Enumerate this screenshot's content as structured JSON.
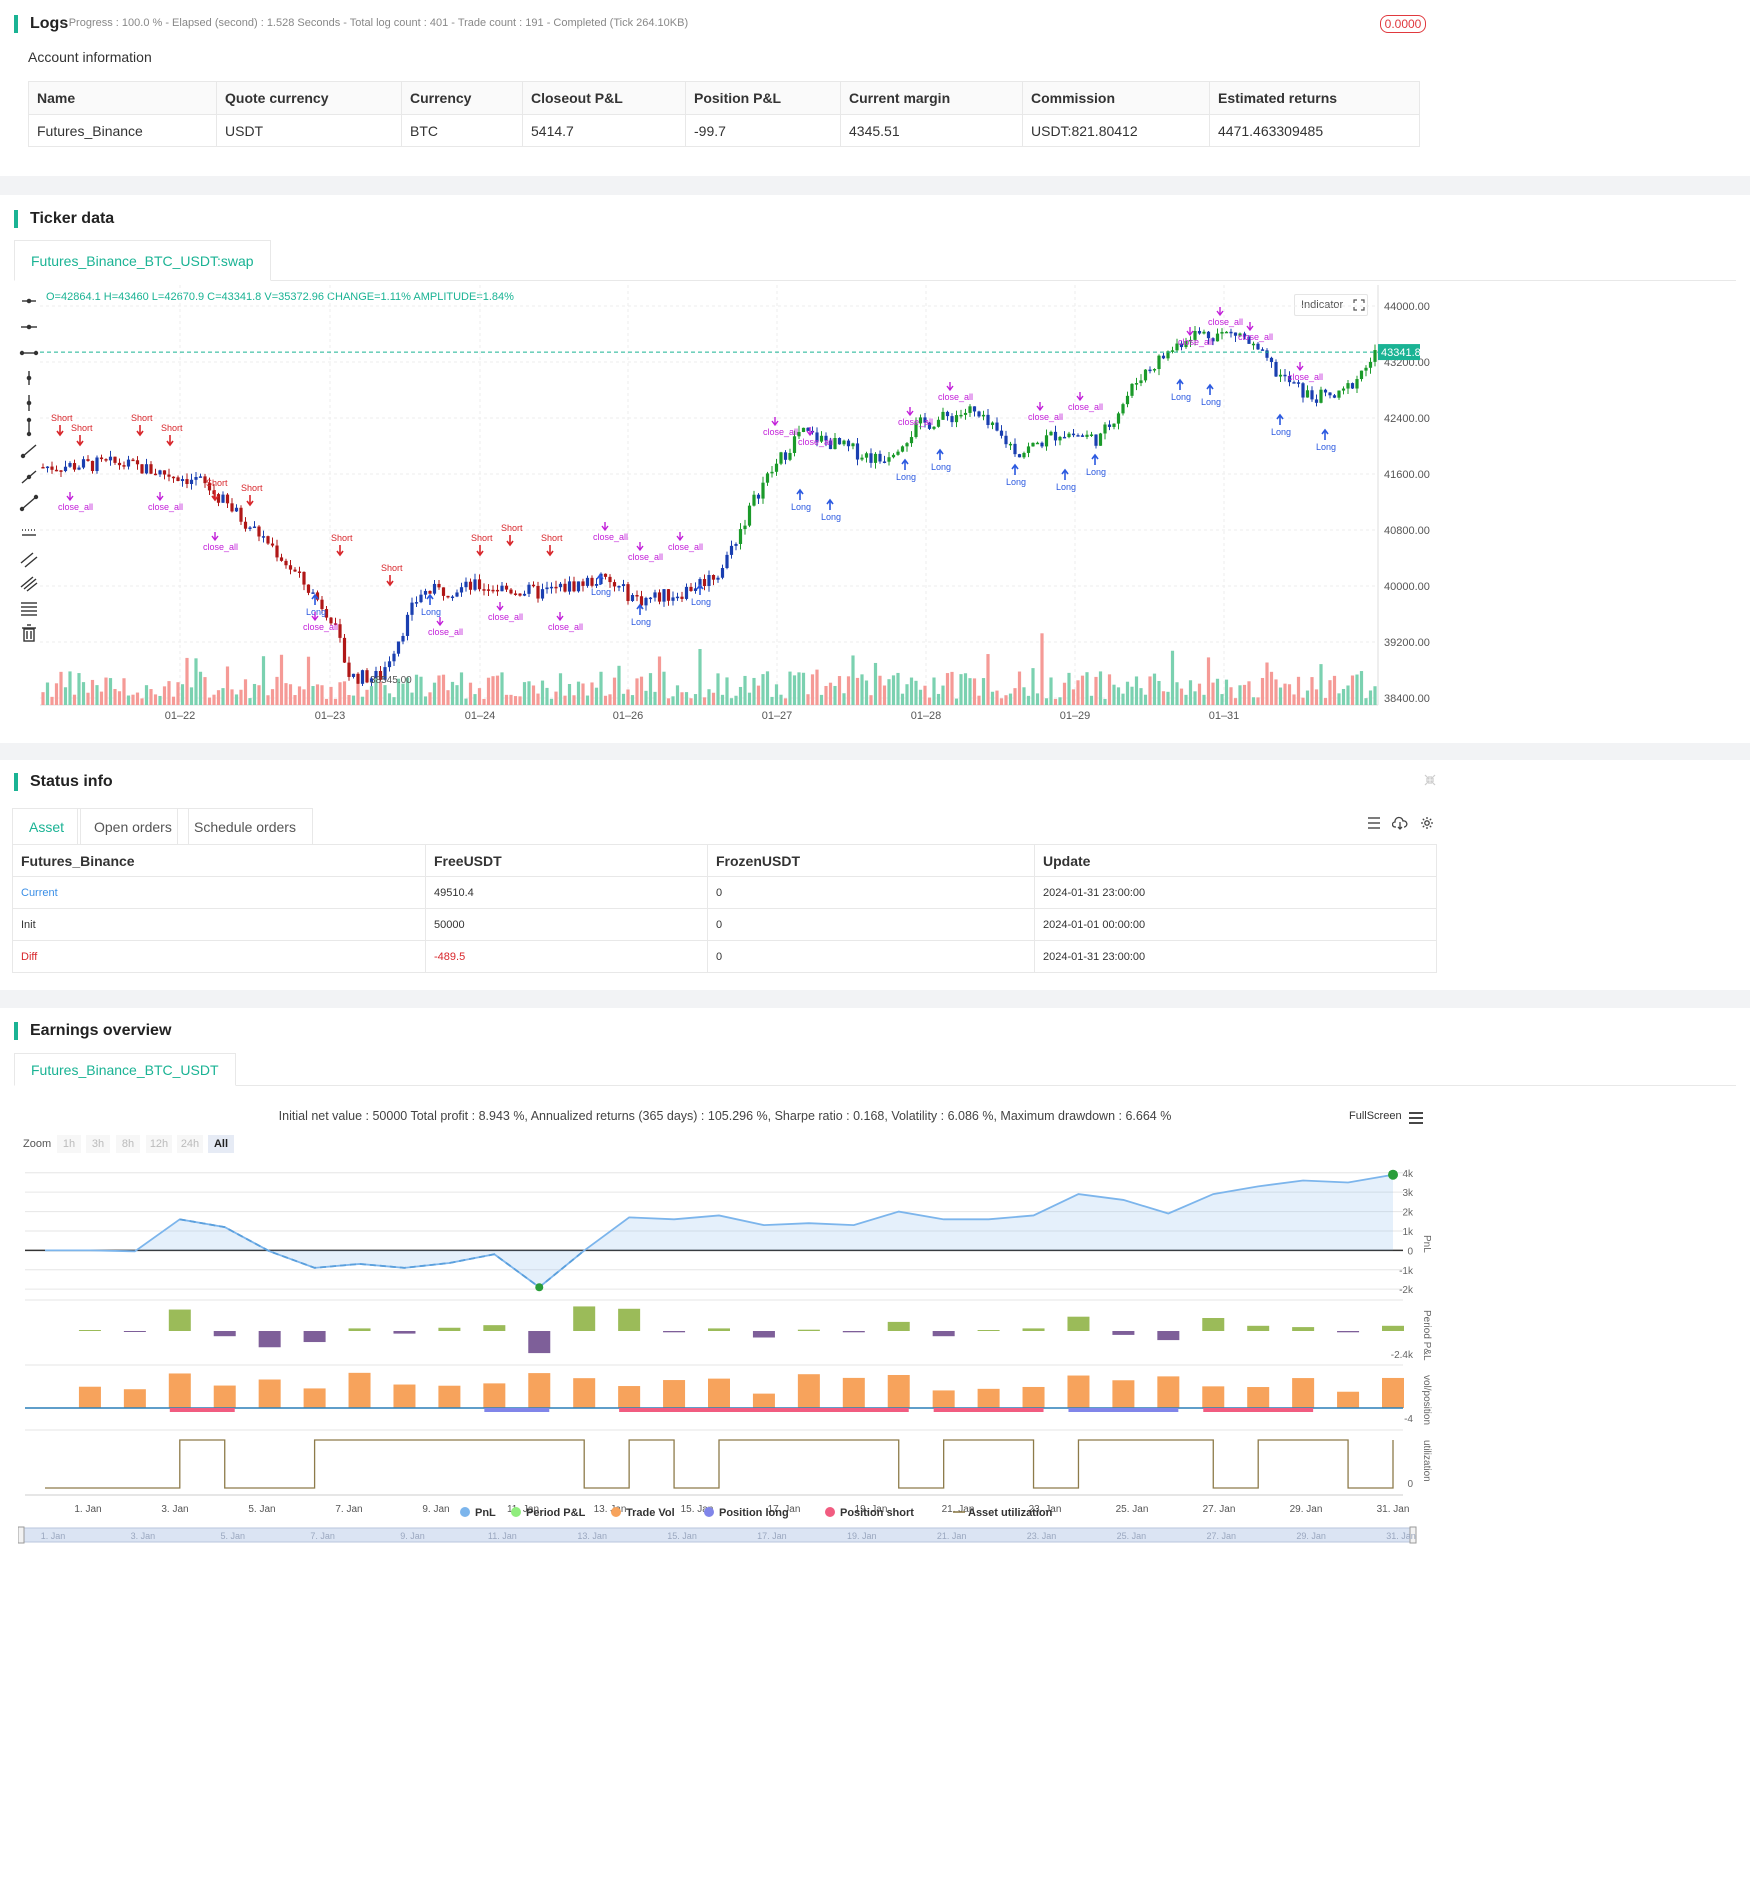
{
  "logs": {
    "title": "Logs",
    "status": "- Progress : 100.0 % - Elapsed (second) : 1.528  Seconds - Total log count : 401 - Trade count : 191 - Completed (Tick 264.10KB)",
    "badge": "0.0000",
    "account_title": "Account information",
    "headers": [
      "Name",
      "Quote currency",
      "Currency",
      "Closeout P&L",
      "Position P&L",
      "Current margin",
      "Commission",
      "Estimated returns"
    ],
    "row": [
      "Futures_Binance",
      "USDT",
      "BTC",
      "5414.7",
      "-99.7",
      "4345.51",
      "USDT:821.80412",
      "4471.463309485"
    ]
  },
  "ticker": {
    "title": "Ticker data",
    "tab": "Futures_Binance_BTC_USDT:swap",
    "ohlc": "O=42864.1 H=43460 L=42670.9 C=43341.8 V=35372.96 CHANGE=1.11% AMPLITUDE=1.84%",
    "indicator_label": "Indicator",
    "last_price": "43341.80",
    "price_ticks": [
      "44000.00",
      "43200.00",
      "42400.00",
      "41600.00",
      "40800.00",
      "40000.00",
      "39200.00",
      "38400.00"
    ],
    "date_ticks": [
      "01–22",
      "01–23",
      "01–24",
      "01–26",
      "01–27",
      "01–28",
      "01–29",
      "01–31"
    ],
    "low_label": "38545.00",
    "colors": {
      "bull": "#1b9a2a",
      "bear": "#b01717",
      "blue": "#1a3fb0",
      "buy": "#2b59e0",
      "sell": "#d8262b",
      "close": "#c21fd9",
      "vol_up": "#7bd1b0",
      "vol_down": "#f59a96"
    }
  },
  "status": {
    "title": "Status info",
    "tabs": [
      "Asset",
      "Open orders",
      "Schedule orders"
    ],
    "headers": [
      "Futures_Binance",
      "FreeUSDT",
      "FrozenUSDT",
      "Update"
    ],
    "rows": [
      [
        "Current",
        "49510.4",
        "0",
        "2024-01-31 23:00:00"
      ],
      [
        "Init",
        "50000",
        "0",
        "2024-01-01 00:00:00"
      ],
      [
        "Diff",
        "-489.5",
        "0",
        "2024-01-31 23:00:00"
      ]
    ]
  },
  "earnings": {
    "title": "Earnings overview",
    "tab": "Futures_Binance_BTC_USDT",
    "summary": "Initial net value : 50000 Total profit : 8.943 %, Annualized returns (365 days) : 105.296 %, Sharpe ratio : 0.168, Volatility : 6.086 %, Maximum drawdown : 6.664 %",
    "fullscreen": "FullScreen",
    "zoom_label": "Zoom",
    "zoom_buttons": [
      "1h",
      "3h",
      "8h",
      "12h",
      "24h",
      "All"
    ],
    "pnl_ticks": [
      "4k",
      "3k",
      "2k",
      "1k",
      "0",
      "-1k",
      "-2k"
    ],
    "period_tick": "-2.4k",
    "vol_tick": "-4",
    "util_tick": "0",
    "axis_titles": [
      "PnL",
      "Period P&L",
      "vol/position",
      "utilization"
    ],
    "date_ticks": [
      "1. Jan",
      "3. Jan",
      "5. Jan",
      "7. Jan",
      "9. Jan",
      "11. Jan",
      "13. Jan",
      "15. Jan",
      "17. Jan",
      "19. Jan",
      "21. Jan",
      "23. Jan",
      "25. Jan",
      "27. Jan",
      "29. Jan",
      "31. Jan"
    ],
    "legend": [
      {
        "label": "PnL",
        "color": "#7cb5ec"
      },
      {
        "label": "Period P&L",
        "color": "#90ed7d"
      },
      {
        "label": "Trade Vol",
        "color": "#f7a35c"
      },
      {
        "label": "Position long",
        "color": "#8085e9"
      },
      {
        "label": "Position short",
        "color": "#f15c80"
      },
      {
        "label": "Asset utilization",
        "color": "#8d7b4a"
      }
    ],
    "pnl_series": [
      0,
      0,
      -50,
      1600,
      1200,
      -50,
      -900,
      -700,
      -900,
      -650,
      -200,
      -1900,
      -10,
      1700,
      1600,
      1800,
      1300,
      1400,
      1300,
      2000,
      1600,
      1600,
      1800,
      2900,
      2600,
      1900,
      2900,
      3300,
      3600,
      3500,
      3900
    ]
  }
}
